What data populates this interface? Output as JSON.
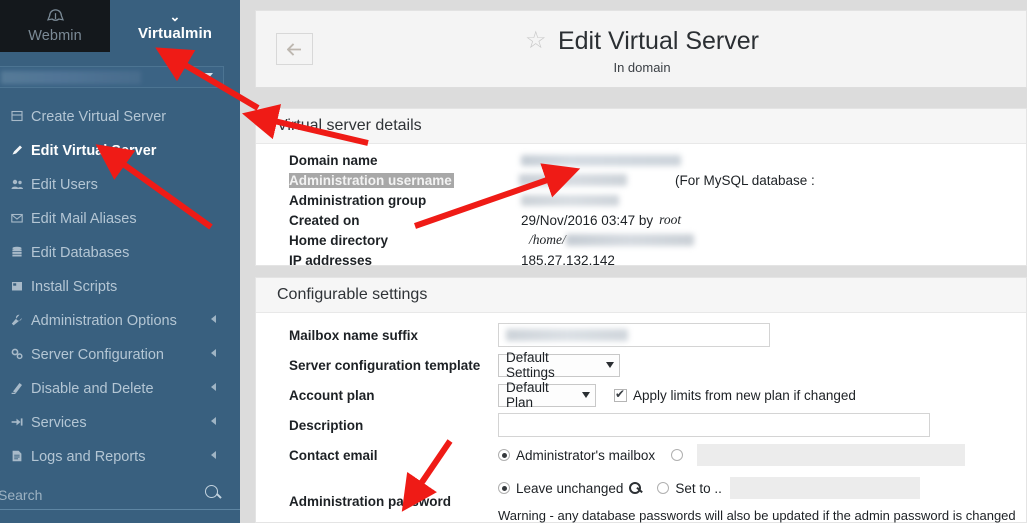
{
  "brand": {
    "webmin_label": "Webmin",
    "webmin_icon": "webmin-logo-icon",
    "virtualmin_label": "Virtualmin",
    "virtualmin_chevron": "⌄"
  },
  "sidebar": {
    "domain_selector": {
      "name": "domain-selector",
      "value": ""
    },
    "items": [
      {
        "label": "Create Virtual Server",
        "icon": "server-add-icon",
        "active": false,
        "has_arrow": false
      },
      {
        "label": "Edit Virtual Server",
        "icon": "pencil-edit-icon",
        "active": true,
        "has_arrow": false
      },
      {
        "label": "Edit Users",
        "icon": "users-icon",
        "active": false,
        "has_arrow": false
      },
      {
        "label": "Edit Mail Aliases",
        "icon": "envelope-icon",
        "active": false,
        "has_arrow": false
      },
      {
        "label": "Edit Databases",
        "icon": "database-icon",
        "active": false,
        "has_arrow": false
      },
      {
        "label": "Install Scripts",
        "icon": "package-icon",
        "active": false,
        "has_arrow": false
      },
      {
        "label": "Administration Options",
        "icon": "wrench-icon",
        "active": false,
        "has_arrow": true
      },
      {
        "label": "Server Configuration",
        "icon": "gears-icon",
        "active": false,
        "has_arrow": true
      },
      {
        "label": "Disable and Delete",
        "icon": "eraser-icon",
        "active": false,
        "has_arrow": true
      },
      {
        "label": "Services",
        "icon": "plug-icon",
        "active": false,
        "has_arrow": true
      },
      {
        "label": "Logs and Reports",
        "icon": "report-icon",
        "active": false,
        "has_arrow": true
      }
    ],
    "search": {
      "placeholder": "Search",
      "value": "",
      "icon": "search-icon"
    }
  },
  "header": {
    "back_icon": "arrow-left-icon",
    "star_icon": "star-outline-icon",
    "title": "Edit Virtual Server",
    "subtitle": "In domain"
  },
  "details_panel": {
    "heading": "Virtual server details",
    "rows": [
      {
        "label": "Domain name",
        "value": "",
        "redacted": true,
        "highlighted": false,
        "suffix": ""
      },
      {
        "label": "Administration username",
        "value": "",
        "redacted": true,
        "highlighted": true,
        "suffix": "(For MySQL database :"
      },
      {
        "label": "Administration group",
        "value": "",
        "redacted": true,
        "highlighted": false,
        "suffix": ""
      },
      {
        "label": "Created on",
        "value": "29/Nov/2016 03:47 by",
        "redacted": false,
        "highlighted": false,
        "suffix": "root"
      },
      {
        "label": "Home directory",
        "value": "/home/",
        "redacted": true,
        "highlighted": false,
        "suffix": ""
      },
      {
        "label": "IP addresses",
        "value": "185.27.132.142",
        "redacted": false,
        "highlighted": false,
        "suffix": ""
      }
    ]
  },
  "settings_panel": {
    "heading": "Configurable settings",
    "mailbox_suffix": {
      "label": "Mailbox name suffix",
      "value": ""
    },
    "server_template": {
      "label": "Server configuration template",
      "selected": "Default Settings"
    },
    "account_plan": {
      "label": "Account plan",
      "selected": "Default Plan",
      "apply_limits_label": "Apply limits from new plan if changed",
      "apply_limits_checked": true
    },
    "description": {
      "label": "Description",
      "value": ""
    },
    "contact_email": {
      "label": "Contact email",
      "option_default": "Administrator's mailbox",
      "option_default_selected": true,
      "option_custom_selected": false,
      "custom_value": ""
    },
    "admin_password": {
      "label": "Administration password",
      "option_leave": "Leave unchanged",
      "option_leave_selected": true,
      "key_icon": "key-icon",
      "option_setto": "Set to ..",
      "option_setto_selected": false,
      "setto_value": "",
      "warning": "Warning - any database passwords will also be updated if the admin password is changed"
    }
  },
  "annotations": {
    "arrow_color": "#ef1b16",
    "arrows": [
      {
        "name": "arrow-to-domain-selector"
      },
      {
        "name": "arrow-to-edit-virtual-server"
      },
      {
        "name": "arrow-to-virtual-server-details"
      },
      {
        "name": "arrow-to-admin-username-value"
      },
      {
        "name": "arrow-to-administration-password"
      }
    ]
  }
}
